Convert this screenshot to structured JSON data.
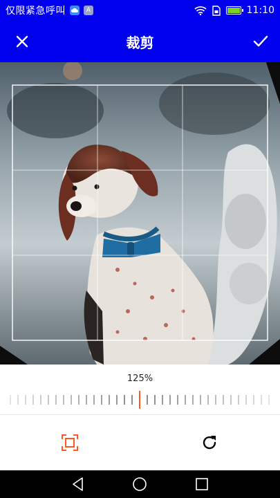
{
  "status_bar": {
    "carrier": "仅限紧急呼叫",
    "time": "11:10",
    "icons": [
      "notification-cloud-icon",
      "notification-a-icon",
      "wifi-icon",
      "sim-icon",
      "battery-icon"
    ],
    "notif_a_glyph": "A"
  },
  "app_bar": {
    "title": "裁剪",
    "close_icon": "close-icon",
    "done_icon": "check-icon",
    "background": "#0000ee"
  },
  "crop": {
    "grid_rows": 3,
    "grid_cols": 3,
    "photo_description_icon": "dog-photo"
  },
  "zoom": {
    "label": "125%",
    "value_percent": 125,
    "accent": "#ff5722"
  },
  "tools": {
    "aspect_icon": "aspect-ratio-icon",
    "rotate_icon": "rotate-icon",
    "aspect_color": "#ff5722"
  },
  "nav_bar": {
    "icons": [
      "back-icon",
      "home-icon",
      "recents-icon"
    ]
  }
}
